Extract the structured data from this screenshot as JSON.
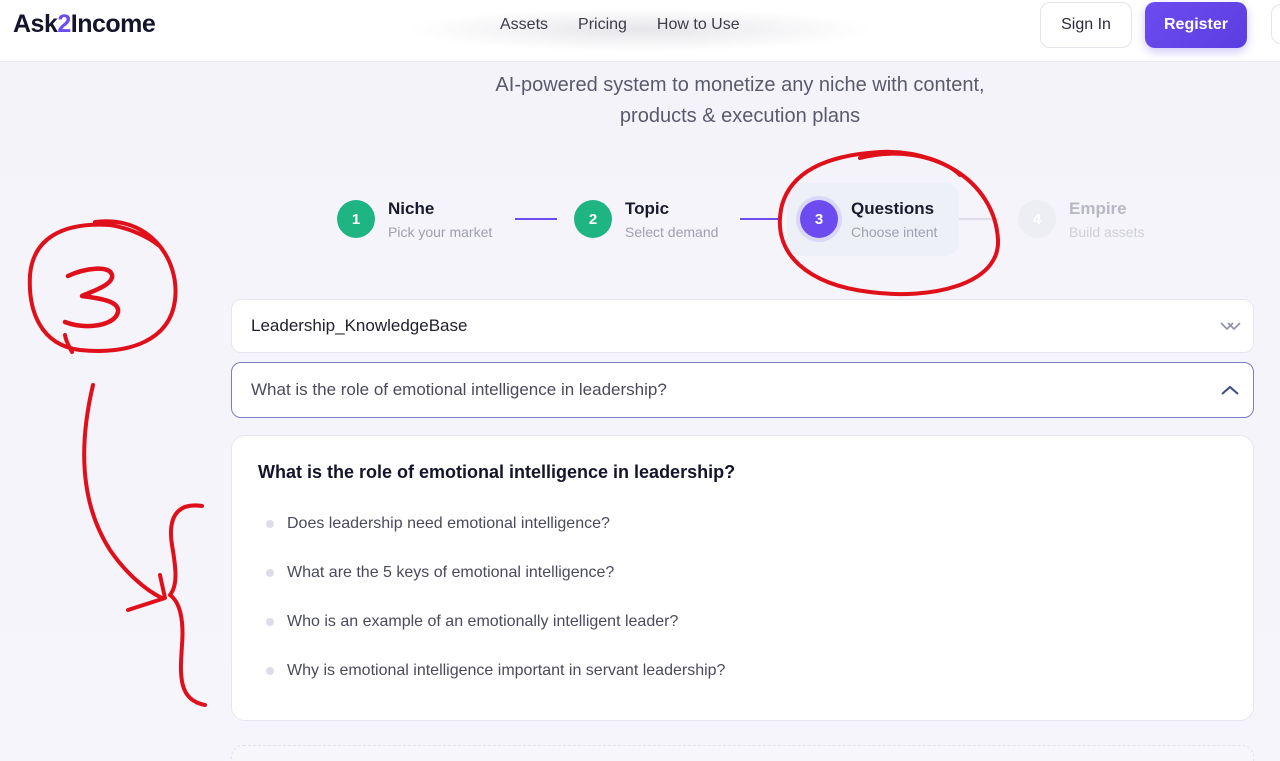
{
  "header": {
    "logo_prefix": "Ask",
    "logo_two": "2",
    "logo_suffix": "Income",
    "nav": [
      "Assets",
      "Pricing",
      "How to Use"
    ],
    "sign_in": "Sign In",
    "register": "Register"
  },
  "subtitle": {
    "line1": "AI-powered system to monetize any niche with content,",
    "line2": "products & execution plans"
  },
  "steps": [
    {
      "num": "1",
      "title": "Niche",
      "desc": "Pick your market",
      "state": "done"
    },
    {
      "num": "2",
      "title": "Topic",
      "desc": "Select demand",
      "state": "done"
    },
    {
      "num": "3",
      "title": "Questions",
      "desc": "Choose intent",
      "state": "active"
    },
    {
      "num": "4",
      "title": "Empire",
      "desc": "Build assets",
      "state": "pending"
    }
  ],
  "topic_select": {
    "value": "Leadership_KnowledgeBase"
  },
  "question_select": {
    "value": "What is the role of emotional intelligence in leadership?"
  },
  "card": {
    "title": "What is the role of emotional intelligence in leadership?",
    "questions": [
      "Does leadership need emotional intelligence?",
      "What are the 5 keys of emotional intelligence?",
      "Who is an example of an emotionally intelligent leader?",
      "Why is emotional intelligence important in servant leadership?"
    ]
  },
  "colors": {
    "accent": "#6c4cf0",
    "done": "#1fb583",
    "annotation": "#e0101a"
  }
}
